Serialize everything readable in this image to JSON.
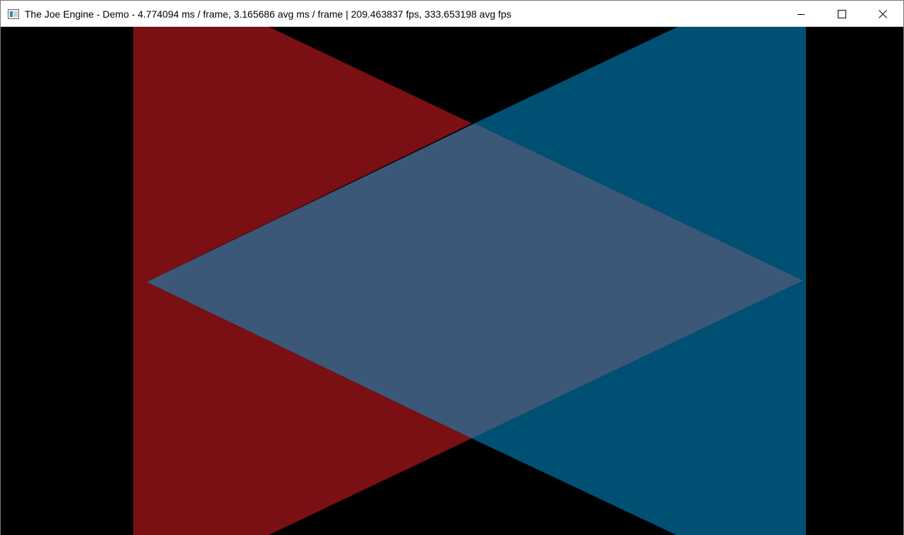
{
  "window": {
    "title": "The Joe Engine - Demo - 4.774094 ms / frame, 3.165686 avg ms / frame | 209.463837 fps, 333.653198 avg fps",
    "icon": "app-window-icon",
    "controls": {
      "minimize": "minimize-icon",
      "maximize": "maximize-icon",
      "close": "close-icon"
    }
  },
  "scene": {
    "background_color": "#000000",
    "left_shape_color": "#7a0f14",
    "right_shape_color": "#005074",
    "overlap_color": "#3b5878"
  }
}
